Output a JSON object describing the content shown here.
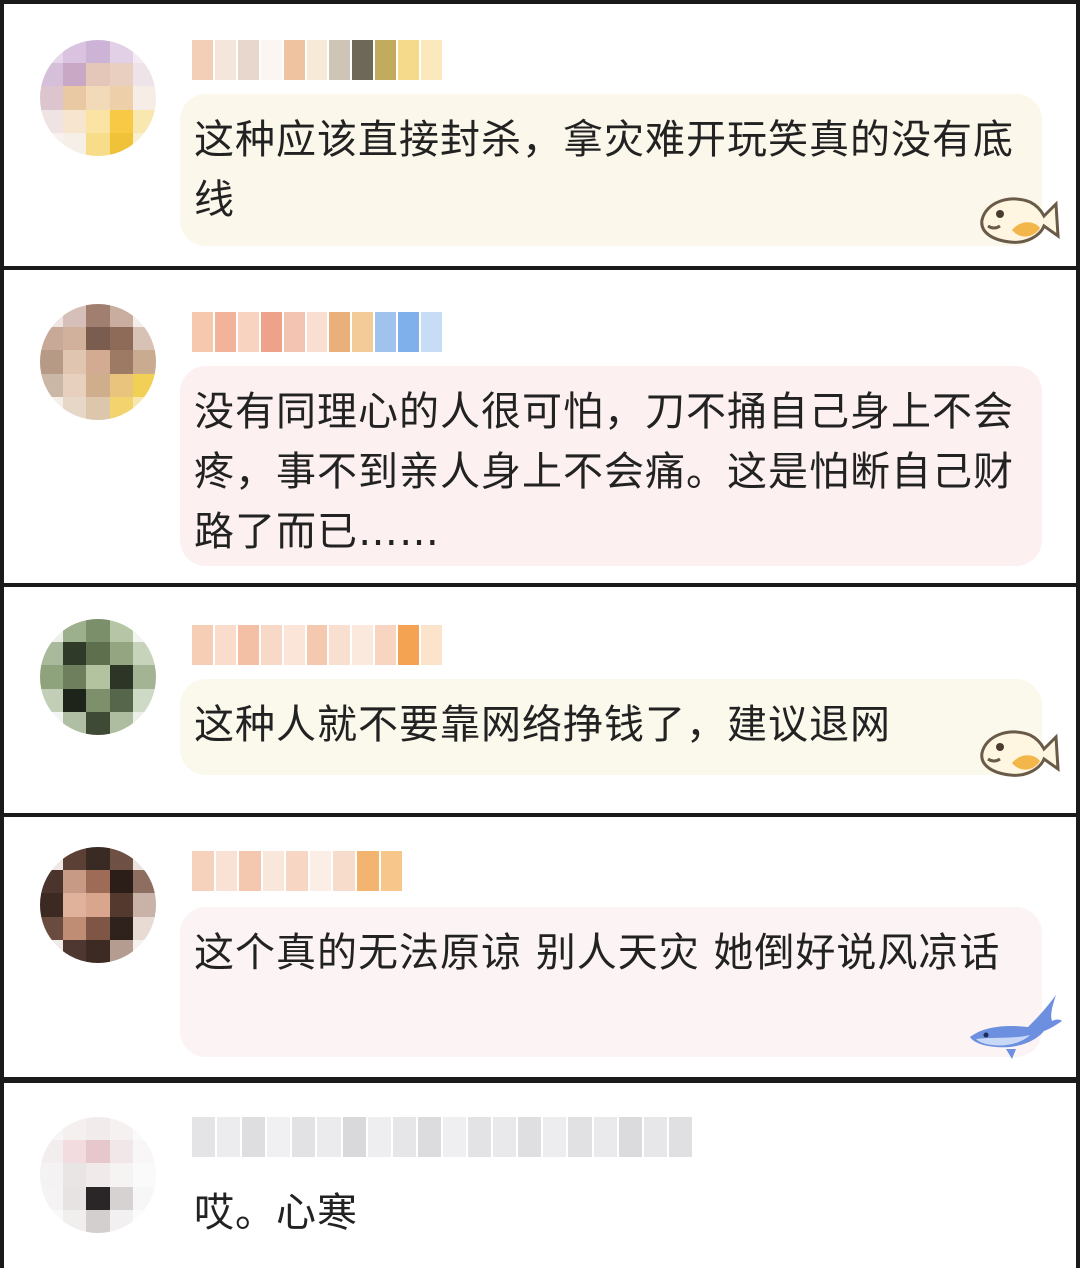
{
  "comments": [
    {
      "text": "这种应该直接封杀，拿灾难开玩笑真的没有底线",
      "username": "",
      "avatar": "pixelated-avatar",
      "sticker": "fish-icon",
      "bubble_color": "#fbf7ea"
    },
    {
      "text": "没有同理心的人很可怕，刀不捅自己身上不会疼，事不到亲人身上不会痛。这是怕断自己财路了而已……",
      "username": "",
      "avatar": "pixelated-avatar",
      "sticker": "",
      "bubble_color": "#fcf0f0"
    },
    {
      "text": "这种人就不要靠网络挣钱了，建议退网",
      "username": "",
      "avatar": "pixelated-avatar",
      "sticker": "fish-icon",
      "bubble_color": "#fbf8ec"
    },
    {
      "text": "这个真的无法原谅  别人天灾  她倒好说风凉话",
      "username": "",
      "avatar": "pixelated-avatar",
      "sticker": "whale-icon",
      "bubble_color": "#fcf4f4"
    },
    {
      "text": "哎。心寒",
      "username": "",
      "avatar": "pixelated-avatar",
      "sticker": "",
      "bubble_color": "#ffffff"
    }
  ]
}
